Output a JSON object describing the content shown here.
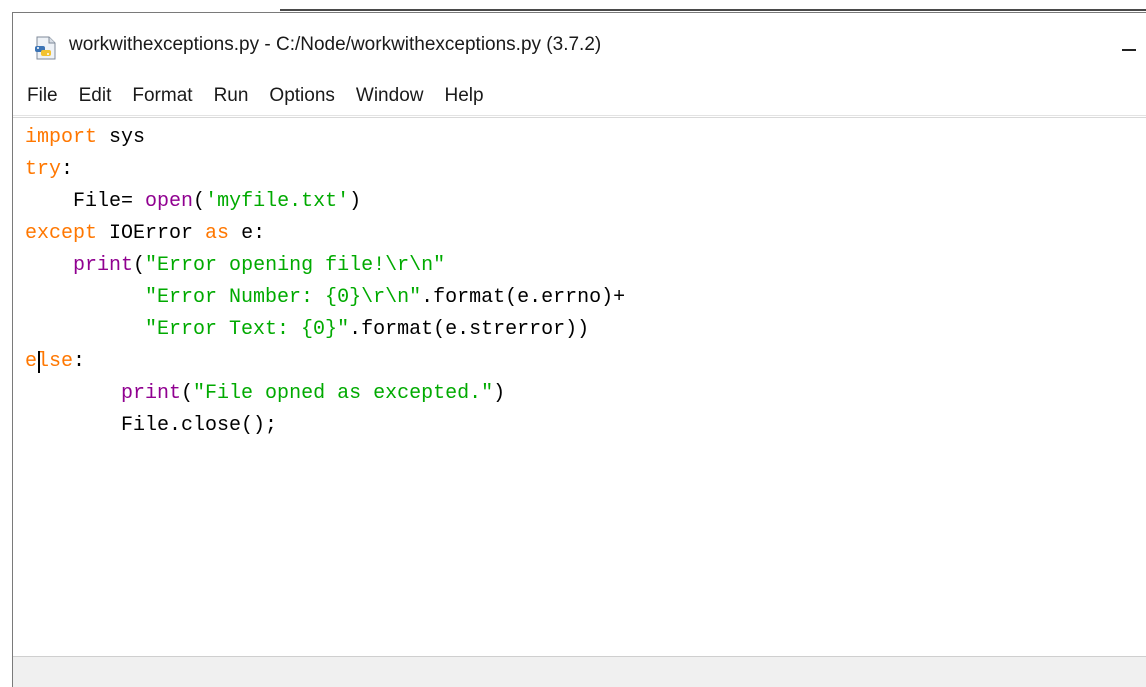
{
  "window": {
    "title": "workwithexceptions.py - C:/Node/workwithexceptions.py (3.7.2)",
    "minimize_glyph": "—"
  },
  "menu": [
    "File",
    "Edit",
    "Format",
    "Run",
    "Options",
    "Window",
    "Help"
  ],
  "icons": {
    "app": "python-idle-file-icon",
    "minimize": "minimize-icon"
  },
  "colors": {
    "keyword": "#ff7700",
    "builtin": "#900090",
    "string": "#00aa00",
    "default": "#000000"
  },
  "editor": {
    "lines": [
      [
        {
          "t": "import",
          "c": "kw"
        },
        {
          "t": " sys",
          "c": "df"
        }
      ],
      [
        {
          "t": "try",
          "c": "kw"
        },
        {
          "t": ":",
          "c": "df"
        }
      ],
      [
        {
          "t": "    File= ",
          "c": "df"
        },
        {
          "t": "open",
          "c": "bi"
        },
        {
          "t": "(",
          "c": "df"
        },
        {
          "t": "'myfile.txt'",
          "c": "st"
        },
        {
          "t": ")",
          "c": "df"
        }
      ],
      [
        {
          "t": "except",
          "c": "kw"
        },
        {
          "t": " IOError ",
          "c": "df"
        },
        {
          "t": "as",
          "c": "kw"
        },
        {
          "t": " e:",
          "c": "df"
        }
      ],
      [
        {
          "t": "    ",
          "c": "df"
        },
        {
          "t": "print",
          "c": "bi"
        },
        {
          "t": "(",
          "c": "df"
        },
        {
          "t": "\"Error opening file!\\r\\n\"",
          "c": "st"
        }
      ],
      [
        {
          "t": "          ",
          "c": "df"
        },
        {
          "t": "\"Error Number: {0}\\r\\n\"",
          "c": "st"
        },
        {
          "t": ".format(e.errno)+",
          "c": "df"
        }
      ],
      [
        {
          "t": "          ",
          "c": "df"
        },
        {
          "t": "\"Error Text: {0}\"",
          "c": "st"
        },
        {
          "t": ".format(e.strerror))",
          "c": "df"
        }
      ],
      [
        {
          "t": "else",
          "c": "kw"
        },
        {
          "t": ":",
          "c": "df"
        }
      ],
      [
        {
          "t": "        ",
          "c": "df"
        },
        {
          "t": "print",
          "c": "bi"
        },
        {
          "t": "(",
          "c": "df"
        },
        {
          "t": "\"File opned as excepted.\"",
          "c": "st"
        },
        {
          "t": ")",
          "c": "df"
        }
      ],
      [
        {
          "t": "        File.close();",
          "c": "df"
        }
      ]
    ]
  }
}
